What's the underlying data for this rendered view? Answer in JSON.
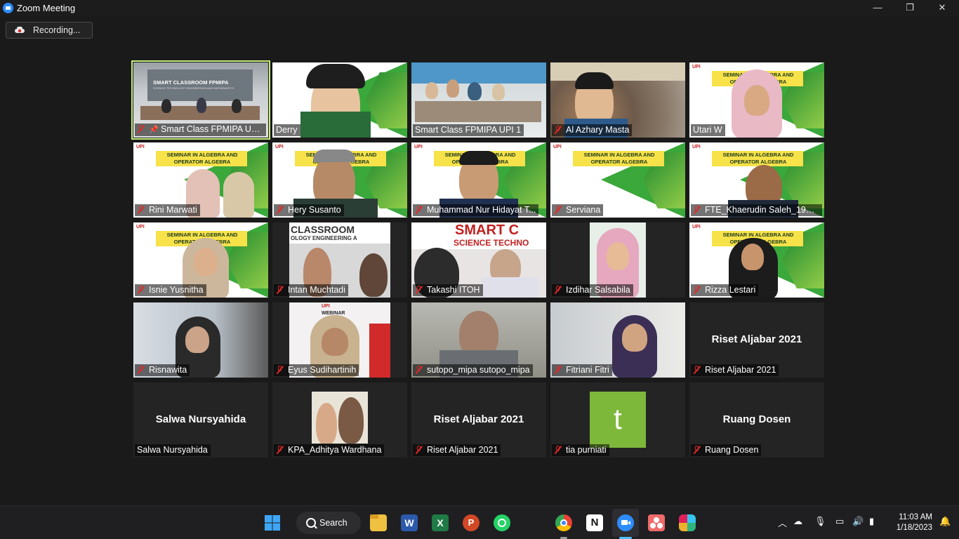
{
  "window": {
    "title": "Zoom Meeting",
    "controls": {
      "minimize": "—",
      "maximize": "❐",
      "close": "✕"
    }
  },
  "recording": {
    "label": "Recording..."
  },
  "participants": [
    {
      "name": "Smart Class FPMIPA UPI 2",
      "muted": true,
      "pinned": true,
      "active": true
    },
    {
      "name": "Derry",
      "muted": false
    },
    {
      "name": "Smart Class FPMIPA UPI 1",
      "muted": false
    },
    {
      "name": "Al Azhary Masta",
      "muted": true
    },
    {
      "name": "Utari W",
      "muted": false
    },
    {
      "name": "Rini Marwati",
      "muted": true
    },
    {
      "name": "Hery Susanto",
      "muted": true
    },
    {
      "name": "Muhammad Nur Hidayat T...",
      "muted": true
    },
    {
      "name": "Serviana",
      "muted": true
    },
    {
      "name": "FTE_Khaerudin Saleh_1986...",
      "muted": true
    },
    {
      "name": "Isnie Yusnitha",
      "muted": true
    },
    {
      "name": "Intan Muchtadi",
      "muted": true
    },
    {
      "name": "Takashi ITOH",
      "muted": true
    },
    {
      "name": "Izdihar Salsabila",
      "muted": true
    },
    {
      "name": "Rizza Lestari",
      "muted": true
    },
    {
      "name": "Risnawita",
      "muted": true
    },
    {
      "name": "Eyus Sudihartinih",
      "muted": true
    },
    {
      "name": "sutopo_mipa sutopo_mipa",
      "muted": true
    },
    {
      "name": "Fitriani Fitri",
      "muted": true
    },
    {
      "name": "Riset Aljabar 2021",
      "muted": true,
      "display_name": "Riset Aljabar 2021"
    },
    {
      "name": "Salwa Nursyahida",
      "muted": false,
      "display_name": "Salwa Nursyahida"
    },
    {
      "name": "KPA_Adhitya Wardhana",
      "muted": true
    },
    {
      "name": "Riset Aljabar 2021",
      "muted": true,
      "display_name": "Riset Aljabar 2021"
    },
    {
      "name": "tia purniati",
      "muted": true,
      "avatar_letter": "t"
    },
    {
      "name": "Ruang Dosen",
      "muted": true,
      "display_name": "Ruang Dosen"
    }
  ],
  "backdrop": {
    "seminar_text": "SEMINAR IN ALGEBRA AND OPERATOR ALGEBRA",
    "logo_text": "UPI",
    "smart_classroom": "SMART CLASSROOM FPMIPA",
    "smart_sub": "SCIENCE TECHNOLOGY ENGINEERING AND MATHEMATICS",
    "classroom_text": "CLASSROOM",
    "tech_eng_text": "OLOGY ENGINEERING A",
    "smart_text": "SMART C",
    "science_tech_text": "SCIENCE TECHNO",
    "webinar_text": "WEBINAR"
  },
  "taskbar": {
    "search_label": "Search",
    "time": "11:03 AM",
    "date": "1/18/2023",
    "apps": [
      "windows-start",
      "file-explorer",
      "word",
      "excel",
      "powerpoint",
      "whatsapp",
      "chrome",
      "notion",
      "zoom",
      "asana",
      "slack"
    ]
  },
  "colors": {
    "accent_active": "#c6f07a",
    "mute_red": "#e02828",
    "zoom_blue": "#2d8cff",
    "avatar_green": "#7db83a"
  }
}
